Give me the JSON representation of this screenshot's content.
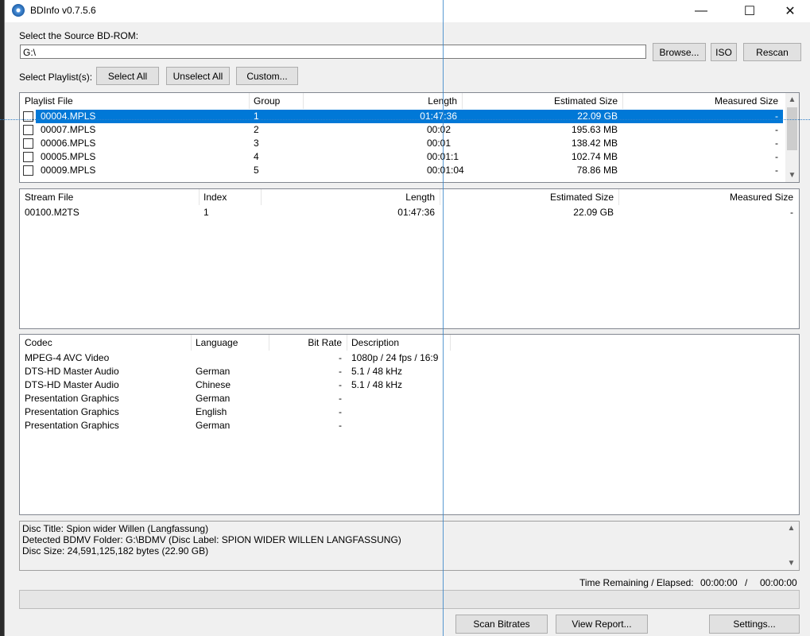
{
  "window": {
    "title": "BDInfo v0.7.5.6",
    "minimize": "—",
    "maximize": "☐",
    "close": "✕"
  },
  "source": {
    "label": "Select the Source BD-ROM:",
    "path": "G:\\",
    "browse": "Browse...",
    "iso": "ISO",
    "rescan": "Rescan"
  },
  "playlist_select": {
    "label": "Select Playlist(s):",
    "select_all": "Select All",
    "unselect_all": "Unselect All",
    "custom": "Custom..."
  },
  "playlists": {
    "headers": {
      "file": "Playlist File",
      "group": "Group",
      "length": "Length",
      "est": "Estimated Size",
      "meas": "Measured Size"
    },
    "rows": [
      {
        "file": "00004.MPLS",
        "group": "1",
        "length": "01:47:36",
        "est": "22.09 GB",
        "meas": "-"
      },
      {
        "file": "00007.MPLS",
        "group": "2",
        "length": "00:02",
        "est": "195.63 MB",
        "meas": "-"
      },
      {
        "file": "00006.MPLS",
        "group": "3",
        "length": "00:01",
        "est": "138.42 MB",
        "meas": "-"
      },
      {
        "file": "00005.MPLS",
        "group": "4",
        "length": "00:01:1",
        "est": "102.74 MB",
        "meas": "-"
      },
      {
        "file": "00009.MPLS",
        "group": "5",
        "length": "00:01:04",
        "est": "78.86 MB",
        "meas": "-"
      }
    ]
  },
  "streams": {
    "headers": {
      "file": "Stream File",
      "index": "Index",
      "length": "Length",
      "est": "Estimated Size",
      "meas": "Measured Size"
    },
    "rows": [
      {
        "file": "00100.M2TS",
        "index": "1",
        "length": "01:47:36",
        "est": "22.09 GB",
        "meas": "-"
      }
    ]
  },
  "codecs": {
    "headers": {
      "codec": "Codec",
      "language": "Language",
      "bitrate": "Bit Rate",
      "desc": "Description"
    },
    "rows": [
      {
        "codec": "MPEG-4 AVC Video",
        "language": "",
        "bitrate": "-",
        "desc": "1080p / 24 fps / 16:9"
      },
      {
        "codec": "DTS-HD Master Audio",
        "language": "German",
        "bitrate": "-",
        "desc": "5.1 / 48 kHz"
      },
      {
        "codec": "DTS-HD Master Audio",
        "language": "Chinese",
        "bitrate": "-",
        "desc": "5.1 / 48 kHz"
      },
      {
        "codec": "Presentation Graphics",
        "language": "German",
        "bitrate": "-",
        "desc": ""
      },
      {
        "codec": "Presentation Graphics",
        "language": "English",
        "bitrate": "-",
        "desc": ""
      },
      {
        "codec": "Presentation Graphics",
        "language": "German",
        "bitrate": "-",
        "desc": ""
      }
    ]
  },
  "info": {
    "line1": "Disc Title: Spion wider Willen (Langfassung)",
    "line2": "Detected BDMV Folder: G:\\BDMV (Disc Label: SPION WIDER WILLEN LANGFASSUNG)",
    "line3": "Disc Size: 24,591,125,182 bytes (22.90 GB)"
  },
  "status": {
    "label": "Time Remaining / Elapsed:",
    "remaining": "00:00:00",
    "sep": "/",
    "elapsed": "00:00:00"
  },
  "buttons": {
    "scan": "Scan Bitrates",
    "report": "View Report...",
    "settings": "Settings..."
  }
}
